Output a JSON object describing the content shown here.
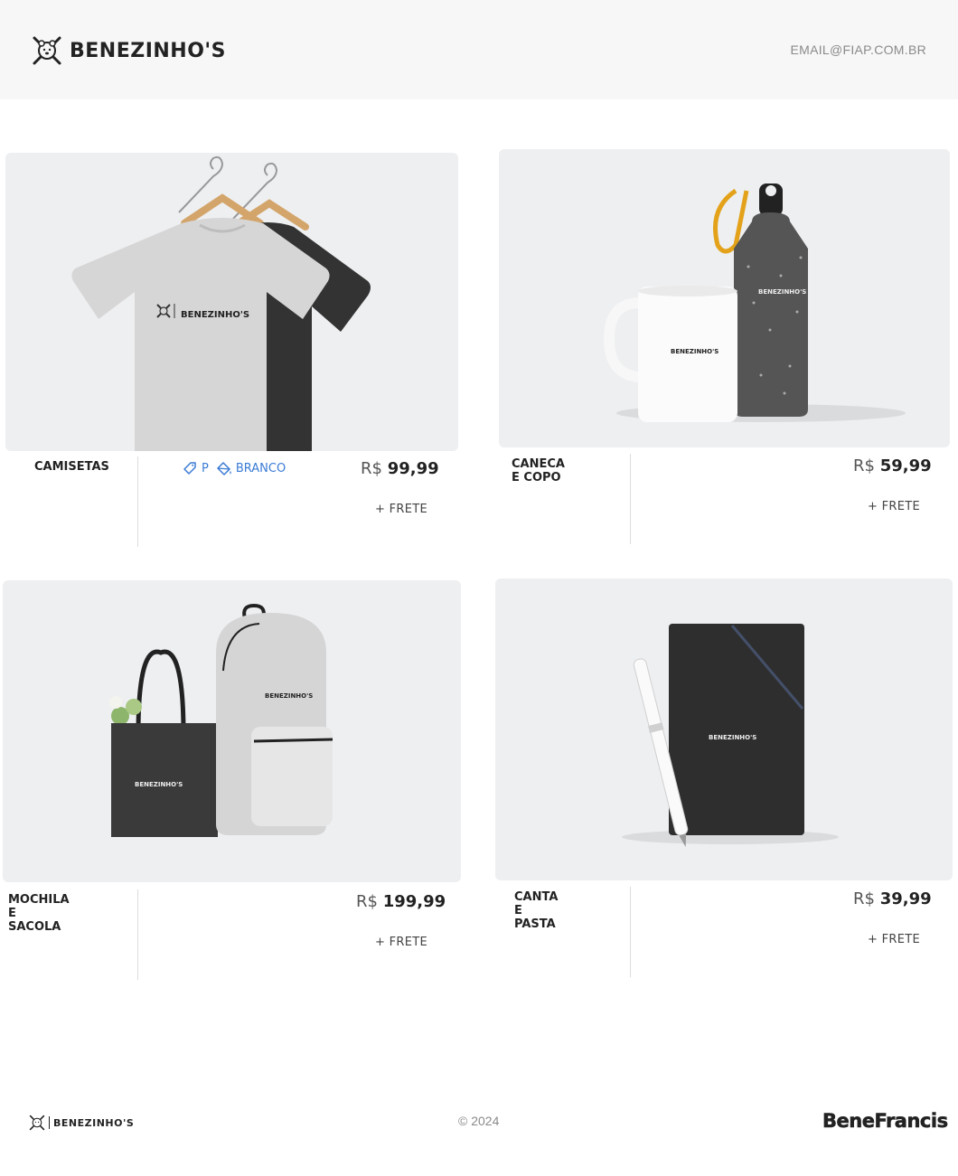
{
  "header": {
    "brand": "BENEZINHO'S",
    "email": "EMAIL@FIAP.COM.BR"
  },
  "products": [
    {
      "title": "CAMISETAS",
      "currency": "R$",
      "price": "99,99",
      "shipping": "+ FRETE",
      "size": "P",
      "color": "BRANCO",
      "logo_text": "BENEZINHO'S"
    },
    {
      "title": "CANECA E COPO",
      "currency": "R$",
      "price": "59,99",
      "shipping": "+ FRETE",
      "logo_text": "BENEZINHO'S"
    },
    {
      "title": "MOCHILA E SACOLA",
      "currency": "R$",
      "price": "199,99",
      "shipping": "+ FRETE",
      "logo_text": "BENEZINHO'S"
    },
    {
      "title": "CANTA E PASTA",
      "currency": "R$",
      "price": "39,99",
      "shipping": "+ FRETE",
      "logo_text": "BENEZINHO'S"
    }
  ],
  "footer": {
    "brand": "BENEZINHO'S",
    "copyright": "© 2024",
    "partner": "BeneFrancis"
  },
  "icons": {
    "brand": "bear-crossed-bats-icon",
    "size_tag": "tag-icon",
    "color": "paint-bucket-icon"
  },
  "colors": {
    "header_bg": "#f7f7f7",
    "image_bg": "#eeeff1",
    "variant_blue": "#3a7bd5",
    "text_dark": "#222222",
    "text_muted": "#8a8a8a"
  }
}
